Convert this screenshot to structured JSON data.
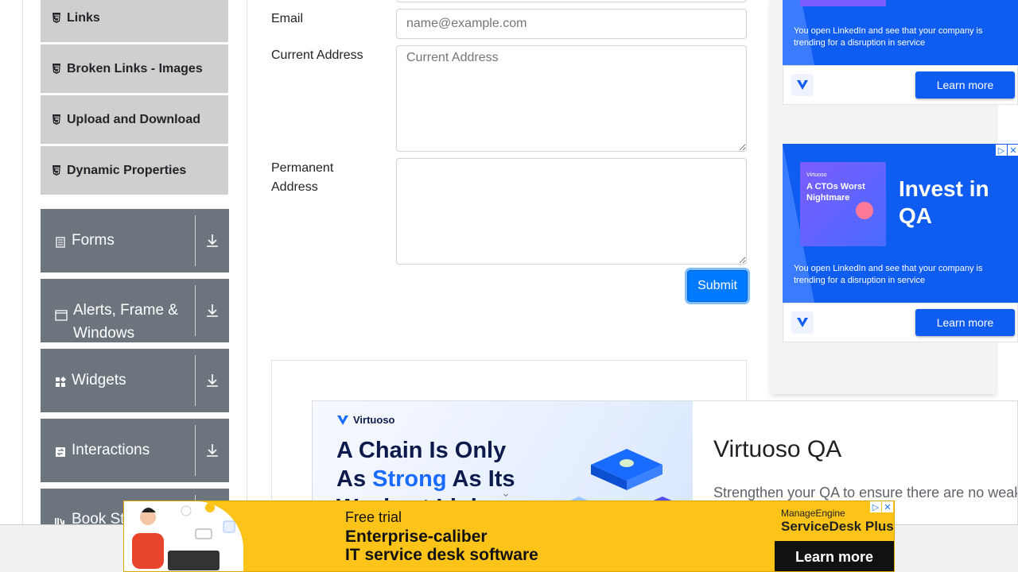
{
  "sidebar": {
    "elements_items": [
      {
        "label": "Links"
      },
      {
        "label": "Broken Links - Images"
      },
      {
        "label": "Upload and Download"
      },
      {
        "label": "Dynamic Properties"
      }
    ],
    "groups": [
      {
        "label": "Forms"
      },
      {
        "label": "Alerts, Frame & Windows"
      },
      {
        "label": "Widgets"
      },
      {
        "label": "Interactions"
      },
      {
        "label": "Book Store"
      }
    ]
  },
  "form": {
    "email_label": "Email",
    "email_placeholder": "name@example.com",
    "current_address_label": "Current Address",
    "current_address_placeholder": "Current Address",
    "permanent_address_label": "Permanent Address",
    "submit_label": "Submit"
  },
  "right_ads": [
    {
      "text": "You open LinkedIn and see that your company is trending for a disruption in service",
      "cta": "Learn more"
    },
    {
      "thumb_brand": "Virtuoso",
      "thumb_title": "A CTOs Worst Nightmare",
      "headline": "Invest in QA",
      "text": "You open LinkedIn and see that your company is trending for a disruption in service",
      "cta": "Learn more"
    }
  ],
  "mid_ad": {
    "brand": "Virtuoso",
    "headline_part1": "A Chain Is Only",
    "headline_part2a": "As ",
    "headline_highlight": "Strong",
    "headline_part2b": " As Its",
    "headline_part3": "Weakest Link",
    "title": "Virtuoso QA",
    "description": "Strengthen your QA to ensure there are no weak links."
  },
  "bottom_ad": {
    "free_trial": "Free trial",
    "line1": "Enterprise-caliber",
    "line2": "IT service desk software",
    "brand_small": "ManageEngine",
    "brand_product": "ServiceDesk Plus",
    "cta": "Learn more"
  },
  "colors": {
    "primary": "#007bff",
    "sidebar_group": "#6c757d",
    "sidebar_item": "#cfcfcf",
    "ad_blue": "#0f5cf0",
    "ad_yellow": "#fcc419"
  }
}
